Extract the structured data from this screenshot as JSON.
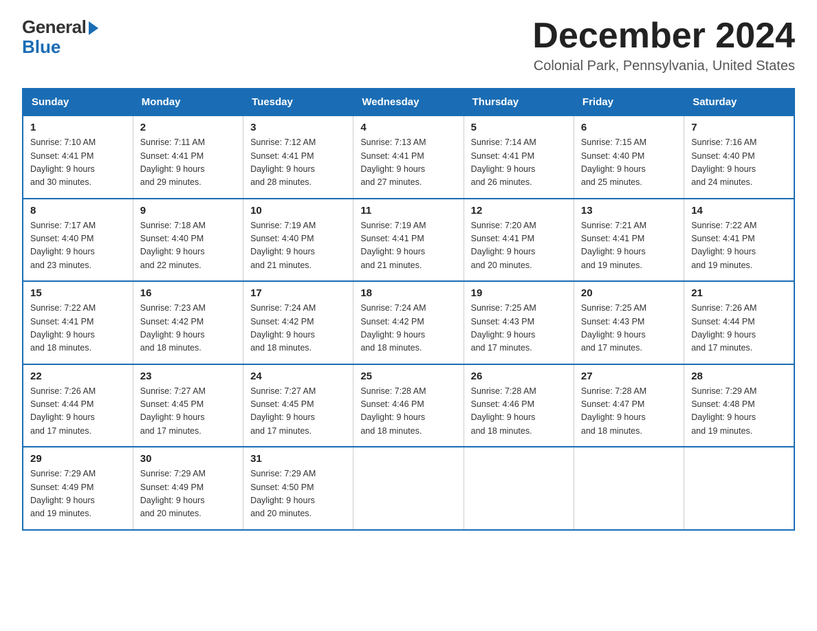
{
  "logo": {
    "general": "General",
    "blue": "Blue"
  },
  "title": "December 2024",
  "location": "Colonial Park, Pennsylvania, United States",
  "weekdays": [
    "Sunday",
    "Monday",
    "Tuesday",
    "Wednesday",
    "Thursday",
    "Friday",
    "Saturday"
  ],
  "weeks": [
    [
      {
        "day": "1",
        "sunrise": "7:10 AM",
        "sunset": "4:41 PM",
        "daylight": "9 hours and 30 minutes."
      },
      {
        "day": "2",
        "sunrise": "7:11 AM",
        "sunset": "4:41 PM",
        "daylight": "9 hours and 29 minutes."
      },
      {
        "day": "3",
        "sunrise": "7:12 AM",
        "sunset": "4:41 PM",
        "daylight": "9 hours and 28 minutes."
      },
      {
        "day": "4",
        "sunrise": "7:13 AM",
        "sunset": "4:41 PM",
        "daylight": "9 hours and 27 minutes."
      },
      {
        "day": "5",
        "sunrise": "7:14 AM",
        "sunset": "4:41 PM",
        "daylight": "9 hours and 26 minutes."
      },
      {
        "day": "6",
        "sunrise": "7:15 AM",
        "sunset": "4:40 PM",
        "daylight": "9 hours and 25 minutes."
      },
      {
        "day": "7",
        "sunrise": "7:16 AM",
        "sunset": "4:40 PM",
        "daylight": "9 hours and 24 minutes."
      }
    ],
    [
      {
        "day": "8",
        "sunrise": "7:17 AM",
        "sunset": "4:40 PM",
        "daylight": "9 hours and 23 minutes."
      },
      {
        "day": "9",
        "sunrise": "7:18 AM",
        "sunset": "4:40 PM",
        "daylight": "9 hours and 22 minutes."
      },
      {
        "day": "10",
        "sunrise": "7:19 AM",
        "sunset": "4:40 PM",
        "daylight": "9 hours and 21 minutes."
      },
      {
        "day": "11",
        "sunrise": "7:19 AM",
        "sunset": "4:41 PM",
        "daylight": "9 hours and 21 minutes."
      },
      {
        "day": "12",
        "sunrise": "7:20 AM",
        "sunset": "4:41 PM",
        "daylight": "9 hours and 20 minutes."
      },
      {
        "day": "13",
        "sunrise": "7:21 AM",
        "sunset": "4:41 PM",
        "daylight": "9 hours and 19 minutes."
      },
      {
        "day": "14",
        "sunrise": "7:22 AM",
        "sunset": "4:41 PM",
        "daylight": "9 hours and 19 minutes."
      }
    ],
    [
      {
        "day": "15",
        "sunrise": "7:22 AM",
        "sunset": "4:41 PM",
        "daylight": "9 hours and 18 minutes."
      },
      {
        "day": "16",
        "sunrise": "7:23 AM",
        "sunset": "4:42 PM",
        "daylight": "9 hours and 18 minutes."
      },
      {
        "day": "17",
        "sunrise": "7:24 AM",
        "sunset": "4:42 PM",
        "daylight": "9 hours and 18 minutes."
      },
      {
        "day": "18",
        "sunrise": "7:24 AM",
        "sunset": "4:42 PM",
        "daylight": "9 hours and 18 minutes."
      },
      {
        "day": "19",
        "sunrise": "7:25 AM",
        "sunset": "4:43 PM",
        "daylight": "9 hours and 17 minutes."
      },
      {
        "day": "20",
        "sunrise": "7:25 AM",
        "sunset": "4:43 PM",
        "daylight": "9 hours and 17 minutes."
      },
      {
        "day": "21",
        "sunrise": "7:26 AM",
        "sunset": "4:44 PM",
        "daylight": "9 hours and 17 minutes."
      }
    ],
    [
      {
        "day": "22",
        "sunrise": "7:26 AM",
        "sunset": "4:44 PM",
        "daylight": "9 hours and 17 minutes."
      },
      {
        "day": "23",
        "sunrise": "7:27 AM",
        "sunset": "4:45 PM",
        "daylight": "9 hours and 17 minutes."
      },
      {
        "day": "24",
        "sunrise": "7:27 AM",
        "sunset": "4:45 PM",
        "daylight": "9 hours and 17 minutes."
      },
      {
        "day": "25",
        "sunrise": "7:28 AM",
        "sunset": "4:46 PM",
        "daylight": "9 hours and 18 minutes."
      },
      {
        "day": "26",
        "sunrise": "7:28 AM",
        "sunset": "4:46 PM",
        "daylight": "9 hours and 18 minutes."
      },
      {
        "day": "27",
        "sunrise": "7:28 AM",
        "sunset": "4:47 PM",
        "daylight": "9 hours and 18 minutes."
      },
      {
        "day": "28",
        "sunrise": "7:29 AM",
        "sunset": "4:48 PM",
        "daylight": "9 hours and 19 minutes."
      }
    ],
    [
      {
        "day": "29",
        "sunrise": "7:29 AM",
        "sunset": "4:49 PM",
        "daylight": "9 hours and 19 minutes."
      },
      {
        "day": "30",
        "sunrise": "7:29 AM",
        "sunset": "4:49 PM",
        "daylight": "9 hours and 20 minutes."
      },
      {
        "day": "31",
        "sunrise": "7:29 AM",
        "sunset": "4:50 PM",
        "daylight": "9 hours and 20 minutes."
      },
      null,
      null,
      null,
      null
    ]
  ],
  "labels": {
    "sunrise": "Sunrise:",
    "sunset": "Sunset:",
    "daylight": "Daylight:"
  }
}
